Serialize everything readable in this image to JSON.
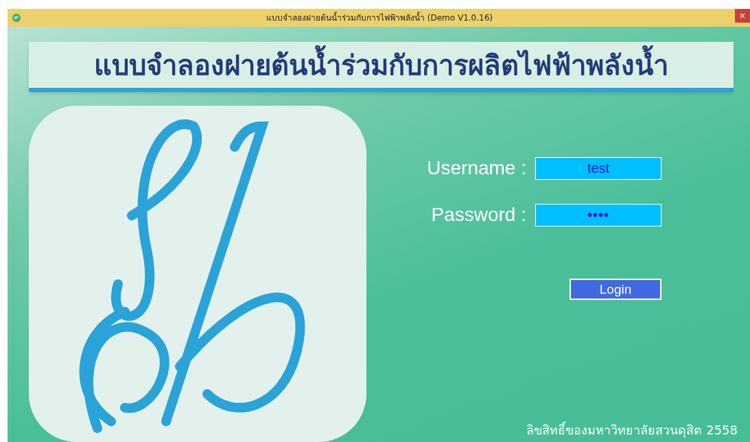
{
  "window": {
    "title": "แบบจำลองฝายต้นน้ำร่วมกับการไฟฟ้าพลังน้ำ (Demo V1.0.16)",
    "close": "×"
  },
  "banner": {
    "title": "แบบจำลองฝายต้นน้ำร่วมกับการผลิตไฟฟ้าพลังน้ำ"
  },
  "form": {
    "fields": [
      {
        "label": "Username :",
        "value": "test",
        "kind": "text"
      },
      {
        "label": "Password :",
        "value": "••••",
        "kind": "password"
      }
    ],
    "button": "Login"
  },
  "footer": "ลิขสิทธิ์ของมหาวิทยาลัยสวนดุสิต  2558"
}
